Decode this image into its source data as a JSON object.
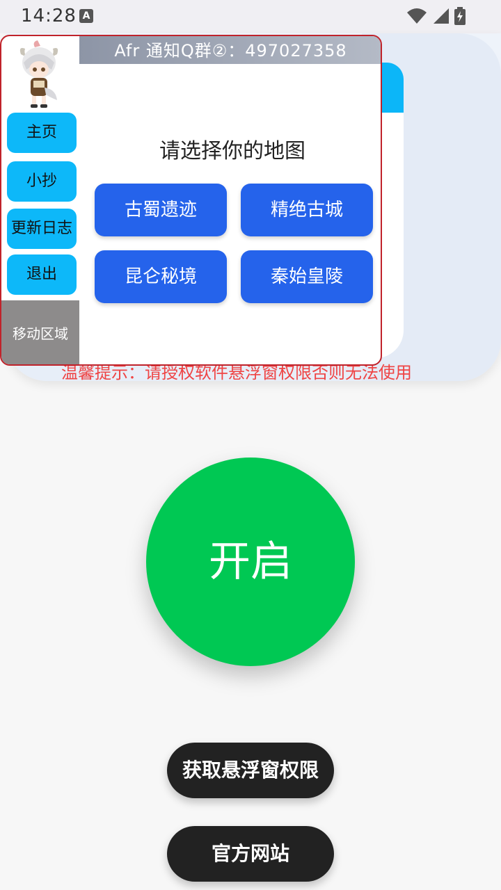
{
  "status_bar": {
    "time": "14:28",
    "notif_icon": "A",
    "icons": [
      "wifi-icon",
      "signal-icon",
      "battery-icon"
    ]
  },
  "floating_window": {
    "header": "Afr 通知Q群②：497027358",
    "nav": {
      "home": "主页",
      "notes": "小抄",
      "changelog": "更新日志",
      "exit": "退出"
    },
    "move_area": "移动区域",
    "map_title": "请选择你的地图",
    "maps": [
      "古蜀遗迹",
      "精绝古城",
      "昆仑秘境",
      "秦始皇陵"
    ]
  },
  "warning": "温馨提示：请授权软件悬浮窗权限否则无法使用",
  "start_button": "开启",
  "permission_button": "获取悬浮窗权限",
  "website_button": "官方网站",
  "colors": {
    "accent_blue": "#2563eb",
    "nav_cyan": "#0db8f9",
    "start_green": "#00c853",
    "warning_red": "#ef4444",
    "border_red": "#c0222a"
  }
}
